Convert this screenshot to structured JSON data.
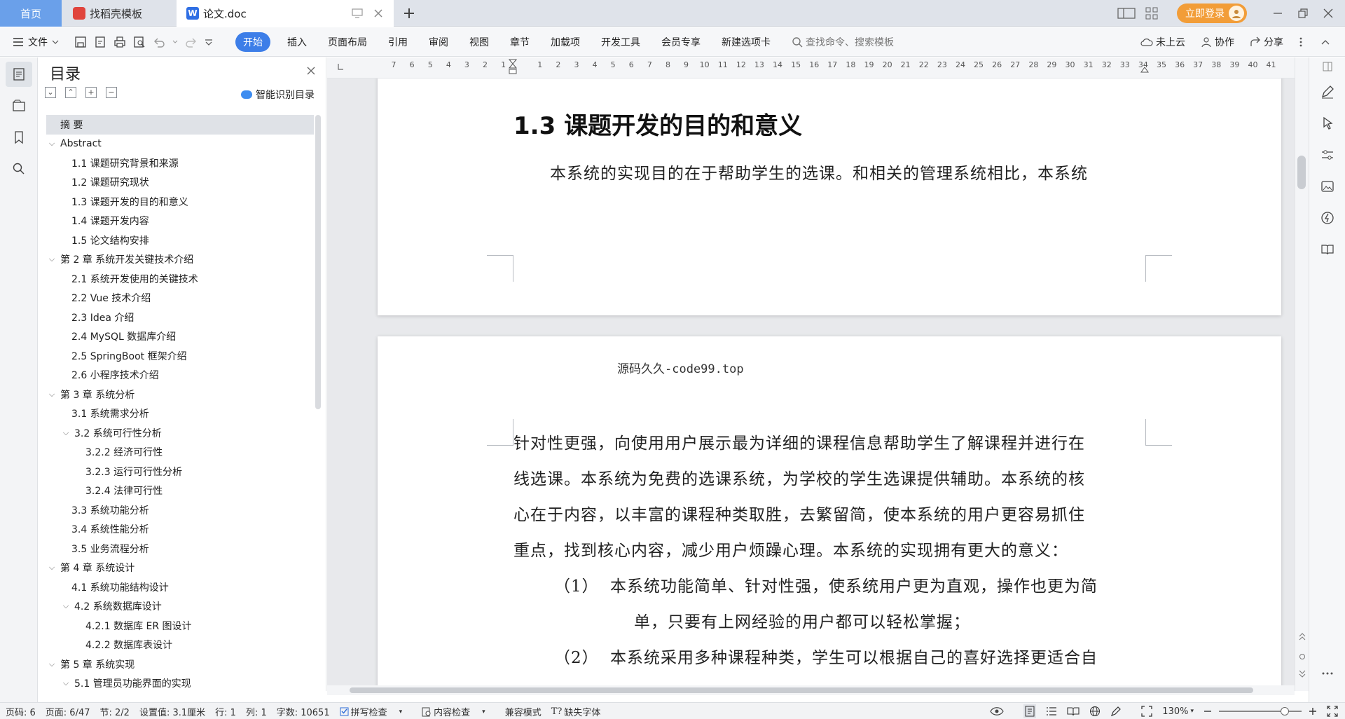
{
  "tabs": {
    "home": "首页",
    "templates": "找稻壳模板",
    "document": "论文.doc"
  },
  "titlebar": {
    "login_label": "立即登录"
  },
  "ribbon": {
    "file_label": "文件",
    "tabs": [
      "开始",
      "插入",
      "页面布局",
      "引用",
      "审阅",
      "视图",
      "章节",
      "加载项",
      "开发工具",
      "会员专享",
      "新建选项卡"
    ],
    "search_placeholder": "查找命令、搜索模板",
    "cloud_label": "未上云",
    "collab_label": "协作",
    "share_label": "分享"
  },
  "toc": {
    "title": "目录",
    "smart_label": "智能识别目录",
    "items": [
      {
        "label": "摘  要",
        "level": 1,
        "chevron": "",
        "selected": true
      },
      {
        "label": "Abstract",
        "level": 1,
        "chevron": "open"
      },
      {
        "label": "1.1 课题研究背景和来源",
        "level": 2,
        "chevron": ""
      },
      {
        "label": "1.2 课题研究现状",
        "level": 2,
        "chevron": ""
      },
      {
        "label": "1.3 课题开发的目的和意义",
        "level": 2,
        "chevron": ""
      },
      {
        "label": "1.4 课题开发内容",
        "level": 2,
        "chevron": ""
      },
      {
        "label": "1.5 论文结构安排",
        "level": 2,
        "chevron": ""
      },
      {
        "label": "第 2 章  系统开发关键技术介绍",
        "level": 1,
        "chevron": "open"
      },
      {
        "label": "2.1 系统开发使用的关键技术",
        "level": 2,
        "chevron": ""
      },
      {
        "label": "2.2 Vue 技术介绍",
        "level": 2,
        "chevron": ""
      },
      {
        "label": "2.3 Idea 介绍",
        "level": 2,
        "chevron": ""
      },
      {
        "label": "2.4 MySQL 数据库介绍",
        "level": 2,
        "chevron": ""
      },
      {
        "label": "2.5 SpringBoot 框架介绍",
        "level": 2,
        "chevron": ""
      },
      {
        "label": "2.6 小程序技术介绍",
        "level": 2,
        "chevron": ""
      },
      {
        "label": "第 3 章  系统分析",
        "level": 1,
        "chevron": "open"
      },
      {
        "label": "3.1 系统需求分析",
        "level": 2,
        "chevron": ""
      },
      {
        "label": "3.2 系统可行性分析",
        "level": 2,
        "chevron": "open"
      },
      {
        "label": "3.2.2 经济可行性",
        "level": 3,
        "chevron": ""
      },
      {
        "label": "3.2.3 运行可行性分析",
        "level": 3,
        "chevron": ""
      },
      {
        "label": "3.2.4 法律可行性",
        "level": 3,
        "chevron": ""
      },
      {
        "label": "3.3 系统功能分析",
        "level": 2,
        "chevron": ""
      },
      {
        "label": "3.4 系统性能分析",
        "level": 2,
        "chevron": ""
      },
      {
        "label": "3.5 业务流程分析",
        "level": 2,
        "chevron": ""
      },
      {
        "label": "第 4 章  系统设计",
        "level": 1,
        "chevron": "open"
      },
      {
        "label": "4.1 系统功能结构设计",
        "level": 2,
        "chevron": ""
      },
      {
        "label": "4.2 系统数据库设计",
        "level": 2,
        "chevron": "open"
      },
      {
        "label": "4.2.1 数据库 ER 图设计",
        "level": 3,
        "chevron": ""
      },
      {
        "label": "4.2.2 数据库表设计",
        "level": 3,
        "chevron": ""
      },
      {
        "label": "第 5 章  系统实现",
        "level": 1,
        "chevron": "open"
      },
      {
        "label": "5.1 管理员功能界面的实现",
        "level": 2,
        "chevron": "open"
      }
    ]
  },
  "ruler": {
    "numbers": [
      "7",
      "6",
      "5",
      "4",
      "3",
      "2",
      "1",
      "",
      "1",
      "2",
      "3",
      "4",
      "5",
      "6",
      "7",
      "8",
      "9",
      "10",
      "11",
      "12",
      "13",
      "14",
      "15",
      "16",
      "17",
      "18",
      "19",
      "20",
      "21",
      "22",
      "23",
      "24",
      "25",
      "26",
      "27",
      "28",
      "29",
      "30",
      "31",
      "32",
      "33",
      "34",
      "35",
      "36",
      "37",
      "38",
      "39",
      "40",
      "41"
    ]
  },
  "document": {
    "heading": "1.3 课题开发的目的和意义",
    "page1_text": "本系统的实现目的在于帮助学生的选课。和相关的管理系统相比，本系统",
    "page_header": "源码久久-code99.top",
    "page2_lines": [
      "针对性更强，向使用用户展示最为详细的课程信息帮助学生了解课程并进行在",
      "线选课。本系统为免费的选课系统，为学校的学生选课提供辅助。本系统的核",
      "心在于内容，以丰富的课程种类取胜，去繁留简，使本系统的用户更容易抓住",
      "重点，找到核心内容，减少用户烦躁心理。本系统的实现拥有更大的意义："
    ],
    "list1_num": "（1）",
    "list1_text": "本系统功能简单、针对性强，使系统用户更为直观，操作也更为简",
    "list1_cont": "单，只要有上网经验的用户都可以轻松掌握；",
    "list2_num": "（2）",
    "list2_text": "本系统采用多种课程种类，学生可以根据自己的喜好选择更适合自"
  },
  "statusbar": {
    "page_no": "页码: 6",
    "pages": "页面: 6/47",
    "section": "节: 2/2",
    "setting": "设置值: 3.1厘米",
    "row": "行: 1",
    "col": "列: 1",
    "wordcount": "字数: 10651",
    "spellcheck": "拼写检查",
    "content_check": "内容检查",
    "compat": "兼容模式",
    "missing_font": "缺失字体",
    "zoom": "130%"
  }
}
